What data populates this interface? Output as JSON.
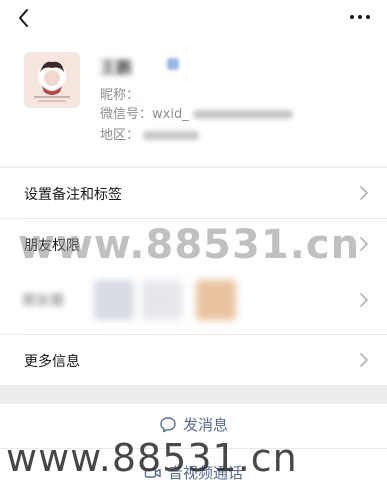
{
  "icons": {
    "back": "chevron-left-icon",
    "more": "more-dots-icon",
    "chevron": "chevron-right-icon",
    "message": "chat-bubble-icon",
    "video": "video-camera-icon"
  },
  "colors": {
    "link": "#576b95",
    "background": "#ededed",
    "card": "#ffffff"
  },
  "profile": {
    "name": "王鹏",
    "nickname_label": "昵称：",
    "nickname_value": ",",
    "wechat_id_label": "微信号：",
    "wechat_id_prefix": "wxid_",
    "region_label": "地区："
  },
  "list": {
    "remark_label": "设置备注和标签",
    "permissions_label": "朋友权限",
    "moments_label": "朋友圈",
    "more_info_label": "更多信息"
  },
  "actions": {
    "message_label": "发消息",
    "call_label": "音视频通话"
  },
  "watermark": {
    "middle_text": "www.88531.cn",
    "bottom_text": "www.88531.cn"
  }
}
